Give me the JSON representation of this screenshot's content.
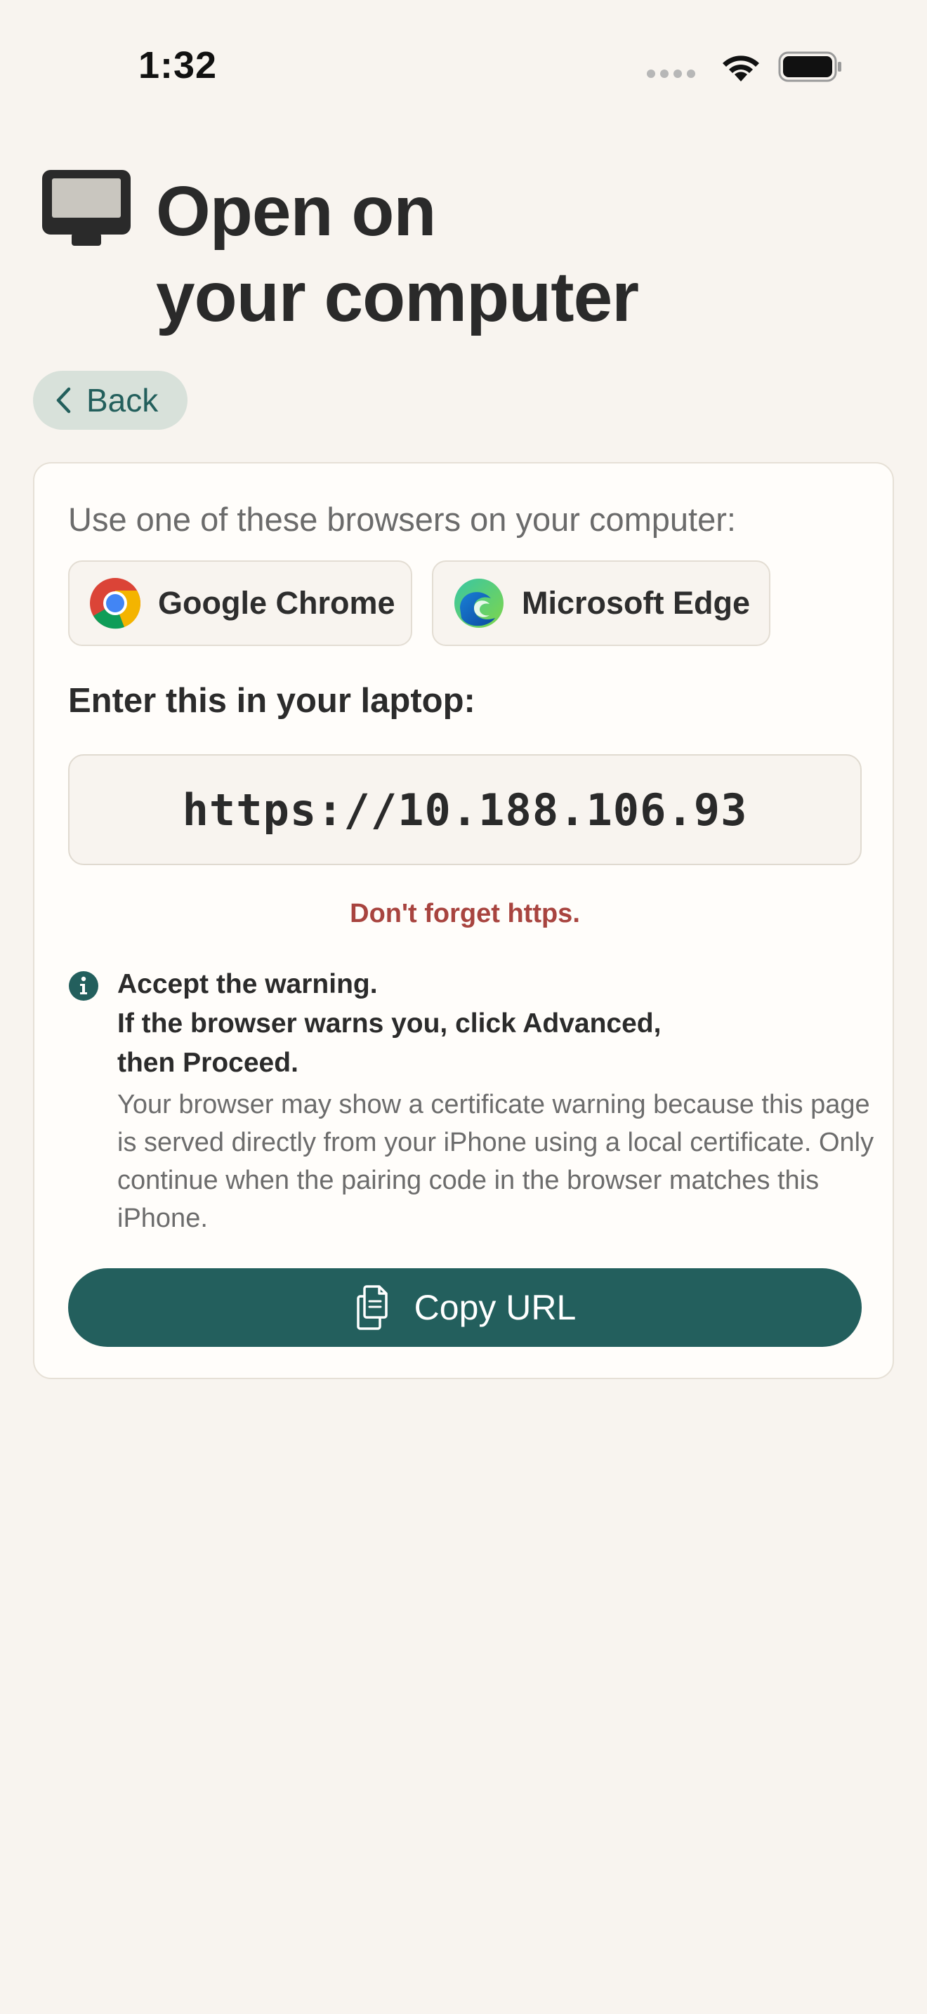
{
  "status_bar": {
    "time": "1:32"
  },
  "header": {
    "title_line1": "Open on",
    "title_line2": "your computer",
    "icon": "desktop-computer-icon"
  },
  "back_button": {
    "label": "Back",
    "icon": "chevron-left-icon"
  },
  "card": {
    "browsers_label": "Use one of these browsers on your computer:",
    "browsers": [
      {
        "label": "Google Chrome",
        "icon": "chrome-logo-icon"
      },
      {
        "label": "Microsoft Edge",
        "icon": "edge-logo-icon"
      }
    ],
    "enter_label": "Enter this in your laptop:",
    "url": "https://10.188.106.93",
    "https_note": "Don't forget https.",
    "info": {
      "icon": "info-icon",
      "title": "Accept the warning.",
      "subtitle_line1": "If the browser warns you, click Advanced,",
      "subtitle_line2": "then Proceed.",
      "body": "Your browser may show a certificate warning because this page is served directly from your iPhone using a local certificate. Only continue when the pairing code in the browser matches this iPhone."
    },
    "copy_button": {
      "label": "Copy URL",
      "icon": "copy-document-icon"
    }
  },
  "colors": {
    "background": "#f8f4ef",
    "accent": "#235f5d",
    "warning_text": "#a8443f",
    "back_button_bg": "#d8e1da"
  }
}
